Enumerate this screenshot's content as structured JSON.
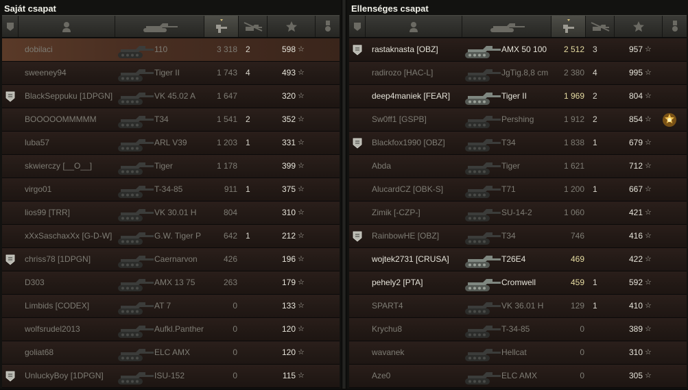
{
  "left": {
    "title": "Saját csapat",
    "sorted_column": "damage",
    "players": [
      {
        "name": "dobilaci",
        "tank": "110",
        "damage": "3 318",
        "kills": "2",
        "xp": "598",
        "rank": false,
        "alive": false,
        "highlight": true,
        "medal": false
      },
      {
        "name": "sweeney94",
        "tank": "Tiger II",
        "damage": "1 743",
        "kills": "4",
        "xp": "493",
        "rank": false,
        "alive": false,
        "highlight": false,
        "medal": false
      },
      {
        "name": "BlackSeppuku [1DPGN]",
        "tank": "VK 45.02 A",
        "damage": "1 647",
        "kills": "",
        "xp": "320",
        "rank": true,
        "alive": false,
        "highlight": false,
        "medal": false
      },
      {
        "name": "BOOOOOMMMMM",
        "tank": "T34",
        "damage": "1 541",
        "kills": "2",
        "xp": "352",
        "rank": false,
        "alive": false,
        "highlight": false,
        "medal": false
      },
      {
        "name": "luba57",
        "tank": "ARL V39",
        "damage": "1 203",
        "kills": "1",
        "xp": "331",
        "rank": false,
        "alive": false,
        "highlight": false,
        "medal": false
      },
      {
        "name": "skwierczy [__O__]",
        "tank": "Tiger",
        "damage": "1 178",
        "kills": "",
        "xp": "399",
        "rank": false,
        "alive": false,
        "highlight": false,
        "medal": false
      },
      {
        "name": "virgo01",
        "tank": "T-34-85",
        "damage": "911",
        "kills": "1",
        "xp": "375",
        "rank": false,
        "alive": false,
        "highlight": false,
        "medal": false
      },
      {
        "name": "lios99 [TRR]",
        "tank": "VK 30.01 H",
        "damage": "804",
        "kills": "",
        "xp": "310",
        "rank": false,
        "alive": false,
        "highlight": false,
        "medal": false
      },
      {
        "name": "xXxSaschaxXx [G-D-W]",
        "tank": "G.W. Tiger P",
        "damage": "642",
        "kills": "1",
        "xp": "212",
        "rank": false,
        "alive": false,
        "highlight": false,
        "medal": false
      },
      {
        "name": "chriss78 [1DPGN]",
        "tank": "Caernarvon",
        "damage": "426",
        "kills": "",
        "xp": "196",
        "rank": true,
        "alive": false,
        "highlight": false,
        "medal": false
      },
      {
        "name": "D303",
        "tank": "AMX 13 75",
        "damage": "263",
        "kills": "",
        "xp": "179",
        "rank": false,
        "alive": false,
        "highlight": false,
        "medal": false
      },
      {
        "name": "Limbids [CODEX]",
        "tank": "AT 7",
        "damage": "0",
        "kills": "",
        "xp": "133",
        "rank": false,
        "alive": false,
        "highlight": false,
        "medal": false
      },
      {
        "name": "wolfsrudel2013",
        "tank": "Aufkl.Panther",
        "damage": "0",
        "kills": "",
        "xp": "120",
        "rank": false,
        "alive": false,
        "highlight": false,
        "medal": false
      },
      {
        "name": "goliat68",
        "tank": "ELC AMX",
        "damage": "0",
        "kills": "",
        "xp": "120",
        "rank": false,
        "alive": false,
        "highlight": false,
        "medal": false
      },
      {
        "name": "UnluckyBoy [1DPGN]",
        "tank": "ISU-152",
        "damage": "0",
        "kills": "",
        "xp": "115",
        "rank": true,
        "alive": false,
        "highlight": false,
        "medal": false
      }
    ]
  },
  "right": {
    "title": "Ellenséges csapat",
    "sorted_column": "damage",
    "players": [
      {
        "name": "rastaknasta [OBZ]",
        "tank": "AMX 50 100",
        "damage": "2 512",
        "kills": "3",
        "xp": "957",
        "rank": true,
        "alive": true,
        "highlight": false,
        "medal": false
      },
      {
        "name": "radirozo [HAC-L]",
        "tank": "JgTig.8,8 cm",
        "damage": "2 380",
        "kills": "4",
        "xp": "995",
        "rank": false,
        "alive": false,
        "highlight": false,
        "medal": false
      },
      {
        "name": "deep4maniek [FEAR]",
        "tank": "Tiger II",
        "damage": "1 969",
        "kills": "2",
        "xp": "804",
        "rank": false,
        "alive": true,
        "highlight": false,
        "medal": false
      },
      {
        "name": "Sw0ff1 [GSPB]",
        "tank": "Pershing",
        "damage": "1 912",
        "kills": "2",
        "xp": "854",
        "rank": false,
        "alive": false,
        "highlight": false,
        "medal": true
      },
      {
        "name": "Blackfox1990 [OBZ]",
        "tank": "T34",
        "damage": "1 838",
        "kills": "1",
        "xp": "679",
        "rank": true,
        "alive": false,
        "highlight": false,
        "medal": false
      },
      {
        "name": "Abda",
        "tank": "Tiger",
        "damage": "1 621",
        "kills": "",
        "xp": "712",
        "rank": false,
        "alive": false,
        "highlight": false,
        "medal": false
      },
      {
        "name": "AlucardCZ [OBK-S]",
        "tank": "T71",
        "damage": "1 200",
        "kills": "1",
        "xp": "667",
        "rank": false,
        "alive": false,
        "highlight": false,
        "medal": false
      },
      {
        "name": "Zimik [-CZP-]",
        "tank": "SU-14-2",
        "damage": "1 060",
        "kills": "",
        "xp": "421",
        "rank": false,
        "alive": false,
        "highlight": false,
        "medal": false
      },
      {
        "name": "RainbowHE [OBZ]",
        "tank": "T34",
        "damage": "746",
        "kills": "",
        "xp": "416",
        "rank": true,
        "alive": false,
        "highlight": false,
        "medal": false
      },
      {
        "name": "wojtek2731 [CRUSA]",
        "tank": "T26E4",
        "damage": "469",
        "kills": "",
        "xp": "422",
        "rank": false,
        "alive": true,
        "highlight": false,
        "medal": false
      },
      {
        "name": "pehely2 [PTA]",
        "tank": "Cromwell",
        "damage": "459",
        "kills": "1",
        "xp": "592",
        "rank": false,
        "alive": true,
        "highlight": false,
        "medal": false
      },
      {
        "name": "SPART4",
        "tank": "VK 36.01 H",
        "damage": "129",
        "kills": "1",
        "xp": "410",
        "rank": false,
        "alive": false,
        "highlight": false,
        "medal": false
      },
      {
        "name": "Krychu8",
        "tank": "T-34-85",
        "damage": "0",
        "kills": "",
        "xp": "389",
        "rank": false,
        "alive": false,
        "highlight": false,
        "medal": false
      },
      {
        "name": "wavanek",
        "tank": "Hellcat",
        "damage": "0",
        "kills": "",
        "xp": "310",
        "rank": false,
        "alive": false,
        "highlight": false,
        "medal": false
      },
      {
        "name": "Aze0",
        "tank": "ELC AMX",
        "damage": "0",
        "kills": "",
        "xp": "305",
        "rank": false,
        "alive": false,
        "highlight": false,
        "medal": false
      }
    ]
  },
  "colors": {
    "alive_text": "#e4e2d8",
    "dead_text": "#7e7c74",
    "damage_alive": "#e6dca2",
    "row_bg": "#231a16",
    "highlight_bg": "#4a2f22"
  },
  "icons": [
    "rank-badge-icon",
    "player-icon",
    "tank-icon",
    "damage-icon",
    "kills-icon",
    "star-icon",
    "medal-icon"
  ]
}
